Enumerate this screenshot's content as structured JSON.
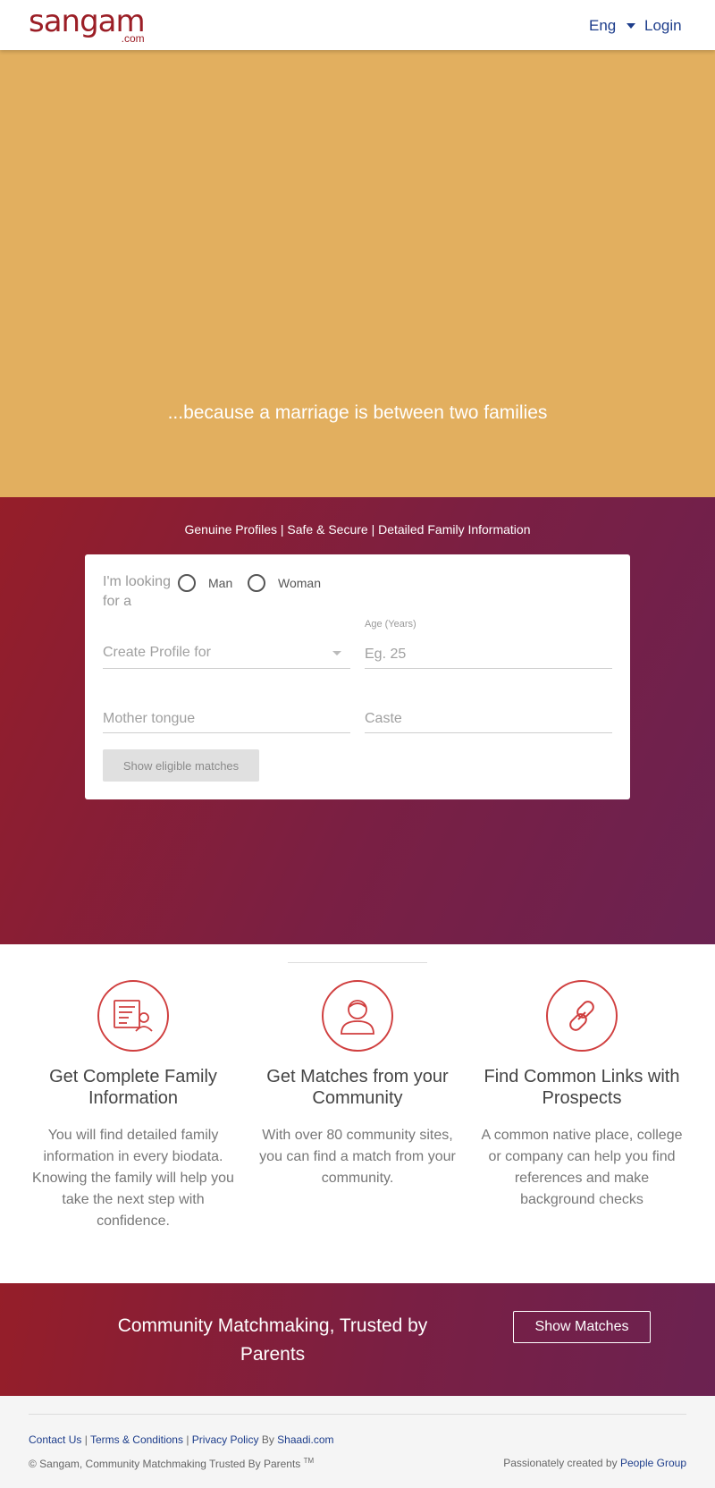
{
  "header": {
    "logo_text": "sangam",
    "logo_suffix": ".com",
    "language": "Eng",
    "login": "Login"
  },
  "hero": {
    "tagline": "...because a marriage is between two families",
    "background": "#e2af5f"
  },
  "form_section": {
    "features_line": "Genuine Profiles | Safe & Secure | Detailed Family Information",
    "looking_for_label": "I'm looking for a",
    "gender_options": [
      "Man",
      "Woman"
    ],
    "create_profile_placeholder": "Create Profile for",
    "age_label": "Age (Years)",
    "age_placeholder": "Eg. 25",
    "mother_tongue_placeholder": "Mother tongue",
    "caste_placeholder": "Caste",
    "submit_label": "Show eligible matches"
  },
  "features": [
    {
      "icon": "biodata-icon",
      "title": "Get Complete Family Information",
      "description": "You will find detailed family information in every biodata. Knowing the family will help you take the next step with confidence."
    },
    {
      "icon": "user-icon",
      "title": "Get Matches from your Community",
      "description": "With over 80 community sites, you can find a match from your community."
    },
    {
      "icon": "link-icon",
      "title": "Find Common Links with Prospects",
      "description": "A common native place, college or company can help you find references and make background checks"
    }
  ],
  "cta": {
    "text": "Community Matchmaking, Trusted by Parents",
    "button": "Show Matches"
  },
  "footer": {
    "links": [
      "Contact Us",
      "Terms & Conditions",
      "Privacy Policy"
    ],
    "by_text": "By",
    "by_link": "Shaadi.com",
    "copyright": "© Sangam, Community Matchmaking Trusted By Parents",
    "trademark": "TM",
    "credit_text": "Passionately created by",
    "credit_link": "People Group"
  },
  "colors": {
    "brand": "#9b1e26",
    "link": "#1d3d8b",
    "accent_icon": "#d03f3f",
    "gradient_start": "#951e29",
    "gradient_end": "#6b2251"
  }
}
